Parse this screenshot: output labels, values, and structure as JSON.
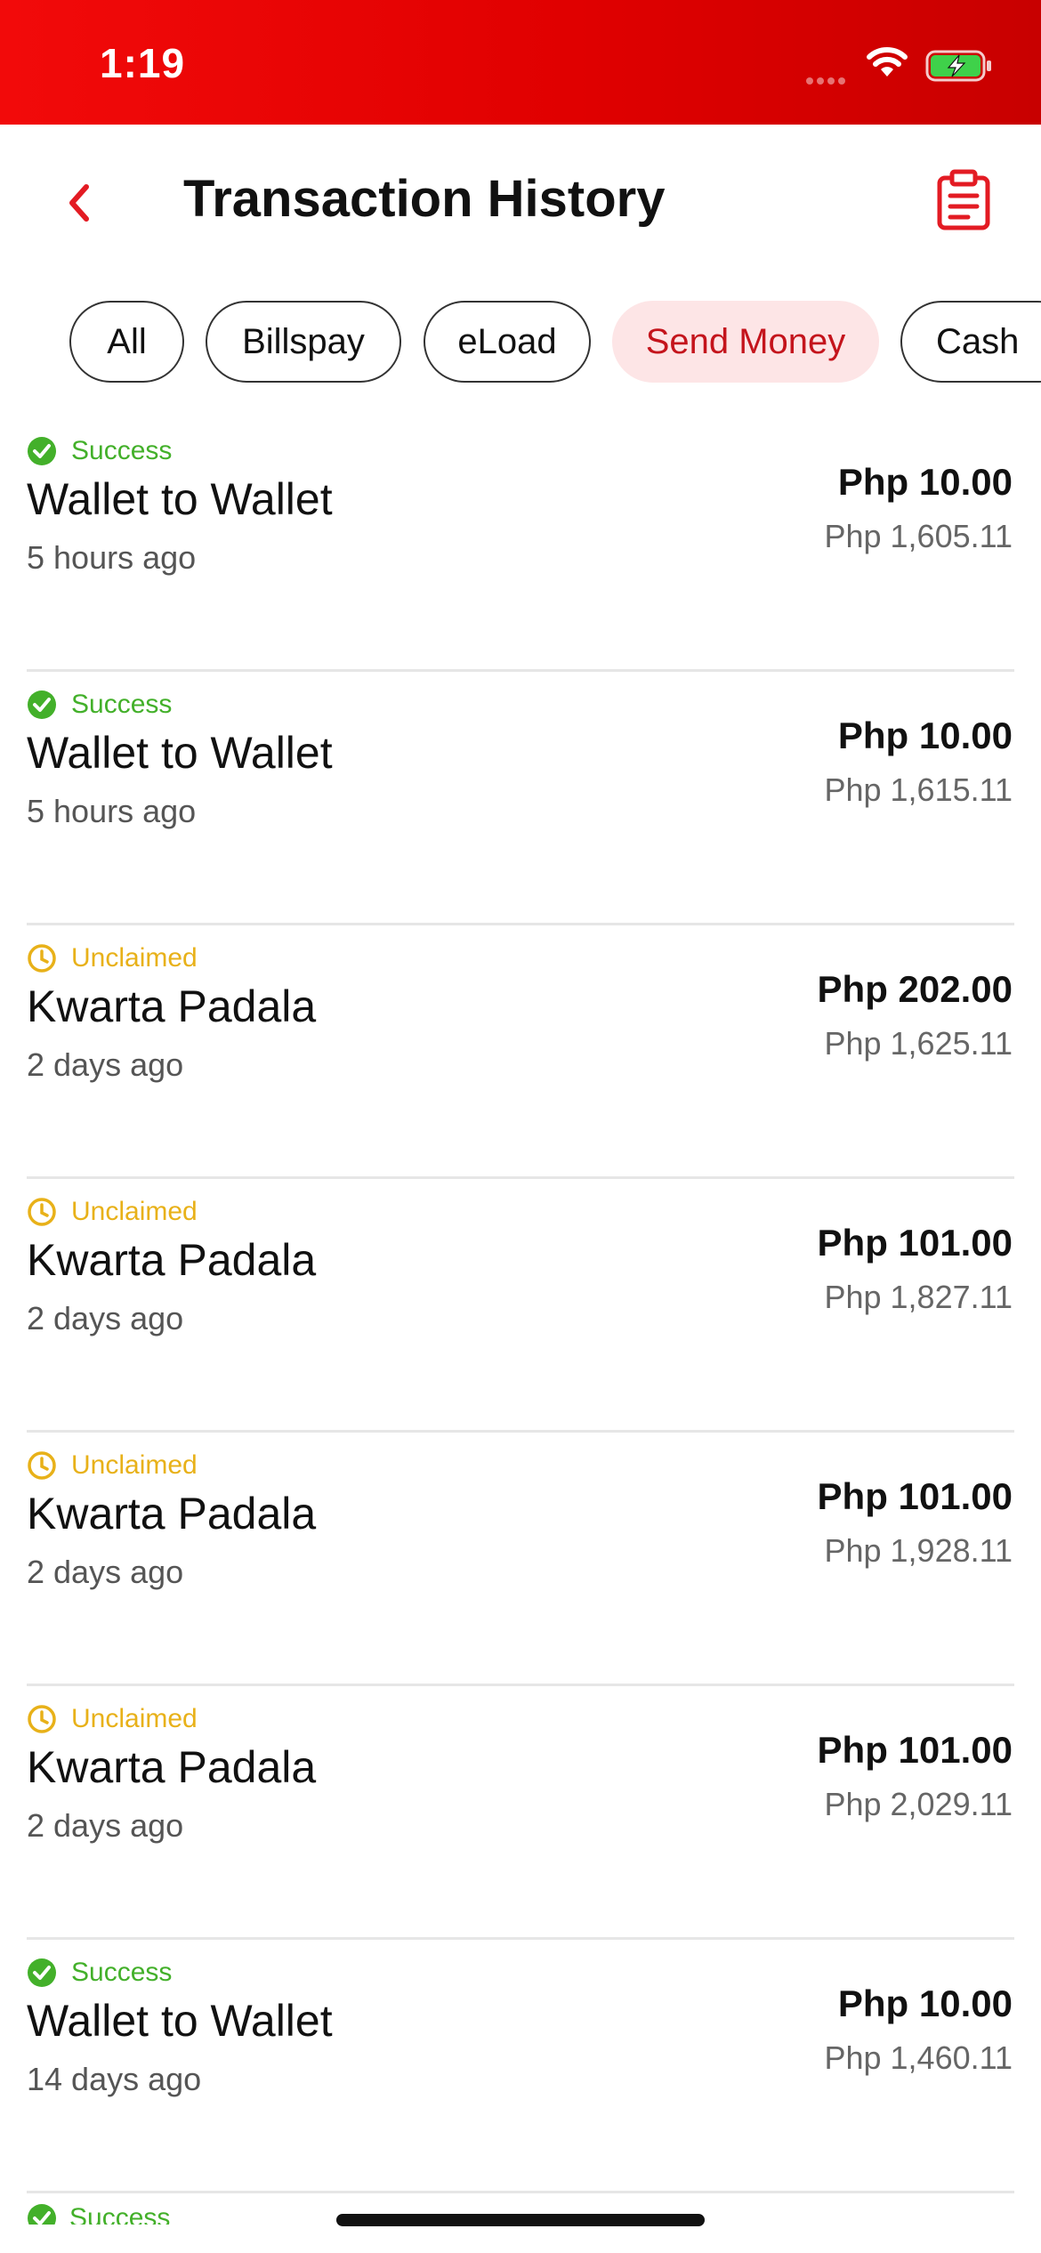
{
  "status_bar": {
    "time": "1:19"
  },
  "header": {
    "title": "Transaction History"
  },
  "filters": [
    {
      "label": "All",
      "active": false
    },
    {
      "label": "Billspay",
      "active": false
    },
    {
      "label": "eLoad",
      "active": false
    },
    {
      "label": "Send Money",
      "active": true
    },
    {
      "label": "Cash",
      "active": false
    }
  ],
  "transactions": [
    {
      "status": "Success",
      "status_type": "success",
      "name": "Wallet to Wallet",
      "time_ago": "5 hours ago",
      "amount": "Php 10.00",
      "balance": "Php 1,605.11"
    },
    {
      "status": "Success",
      "status_type": "success",
      "name": "Wallet to Wallet",
      "time_ago": "5 hours ago",
      "amount": "Php 10.00",
      "balance": "Php 1,615.11"
    },
    {
      "status": "Unclaimed",
      "status_type": "unclaimed",
      "name": "Kwarta Padala",
      "time_ago": "2 days ago",
      "amount": "Php 202.00",
      "balance": "Php 1,625.11"
    },
    {
      "status": "Unclaimed",
      "status_type": "unclaimed",
      "name": "Kwarta Padala",
      "time_ago": "2 days ago",
      "amount": "Php 101.00",
      "balance": "Php 1,827.11"
    },
    {
      "status": "Unclaimed",
      "status_type": "unclaimed",
      "name": "Kwarta Padala",
      "time_ago": "2 days ago",
      "amount": "Php 101.00",
      "balance": "Php 1,928.11"
    },
    {
      "status": "Unclaimed",
      "status_type": "unclaimed",
      "name": "Kwarta Padala",
      "time_ago": "2 days ago",
      "amount": "Php 101.00",
      "balance": "Php 2,029.11"
    },
    {
      "status": "Success",
      "status_type": "success",
      "name": "Wallet to Wallet",
      "time_ago": "14 days ago",
      "amount": "Php 10.00",
      "balance": "Php 1,460.11"
    }
  ],
  "partial_row": {
    "status": "Success"
  },
  "colors": {
    "brand_red": "#e00000",
    "success": "#43b02a",
    "unclaimed": "#e8b119",
    "chip_active_bg": "#fde5e6",
    "chip_active_text": "#c4141c"
  },
  "icons": {
    "back": "chevron-left-icon",
    "history": "clipboard-icon",
    "success": "check-circle-icon",
    "unclaimed": "clock-icon"
  }
}
